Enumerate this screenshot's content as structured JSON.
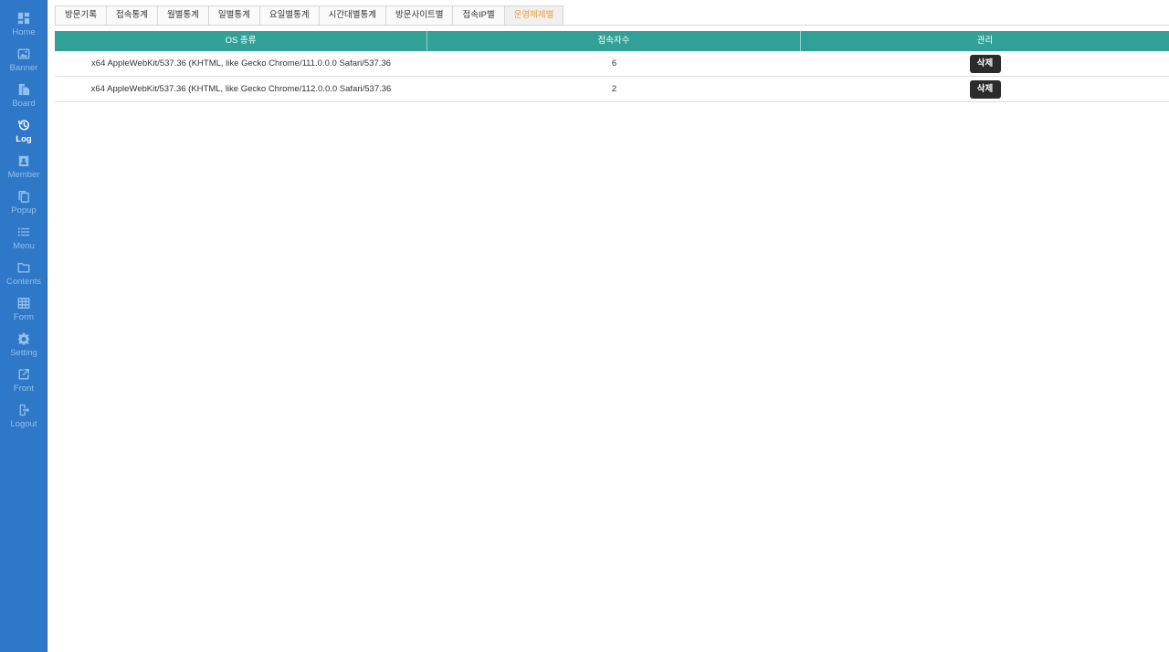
{
  "sidebar": {
    "items": [
      {
        "label": "Home",
        "icon": "dashboard-icon",
        "active": false
      },
      {
        "label": "Banner",
        "icon": "image-icon",
        "active": false
      },
      {
        "label": "Board",
        "icon": "board-icon",
        "active": false
      },
      {
        "label": "Log",
        "icon": "history-icon",
        "active": true
      },
      {
        "label": "Member",
        "icon": "member-badge-icon",
        "active": false
      },
      {
        "label": "Popup",
        "icon": "copy-icon",
        "active": false
      },
      {
        "label": "Menu",
        "icon": "list-icon",
        "active": false
      },
      {
        "label": "Contents",
        "icon": "folder-icon",
        "active": false
      },
      {
        "label": "Form",
        "icon": "grid-table-icon",
        "active": false
      },
      {
        "label": "Setting",
        "icon": "gear-icon",
        "active": false
      },
      {
        "label": "Front",
        "icon": "external-link-icon",
        "active": false
      },
      {
        "label": "Logout",
        "icon": "logout-icon",
        "active": false
      }
    ]
  },
  "tabs": [
    {
      "label": "방문기록",
      "active": false
    },
    {
      "label": "접속통계",
      "active": false
    },
    {
      "label": "월별통계",
      "active": false
    },
    {
      "label": "일별통계",
      "active": false
    },
    {
      "label": "요일별통계",
      "active": false
    },
    {
      "label": "시간대별통계",
      "active": false
    },
    {
      "label": "방문사이트별",
      "active": false
    },
    {
      "label": "접속IP별",
      "active": false
    },
    {
      "label": "운영체제별",
      "active": true
    }
  ],
  "table": {
    "headers": [
      "OS 종류",
      "접속자수",
      "관리"
    ],
    "rows": [
      {
        "os": "x64 AppleWebKit/537.36 (KHTML, like Gecko Chrome/111.0.0.0 Safari/537.36",
        "count": "6",
        "action": "삭제"
      },
      {
        "os": "x64 AppleWebKit/537.36 (KHTML, like Gecko Chrome/112.0.0.0 Safari/537.36",
        "count": "2",
        "action": "삭제"
      }
    ]
  },
  "colors": {
    "sidebar_bg": "#2f77c7",
    "header_bg": "#31a197",
    "active_tab_text": "#e8a13a",
    "delete_button_bg": "#2b2b2b"
  }
}
